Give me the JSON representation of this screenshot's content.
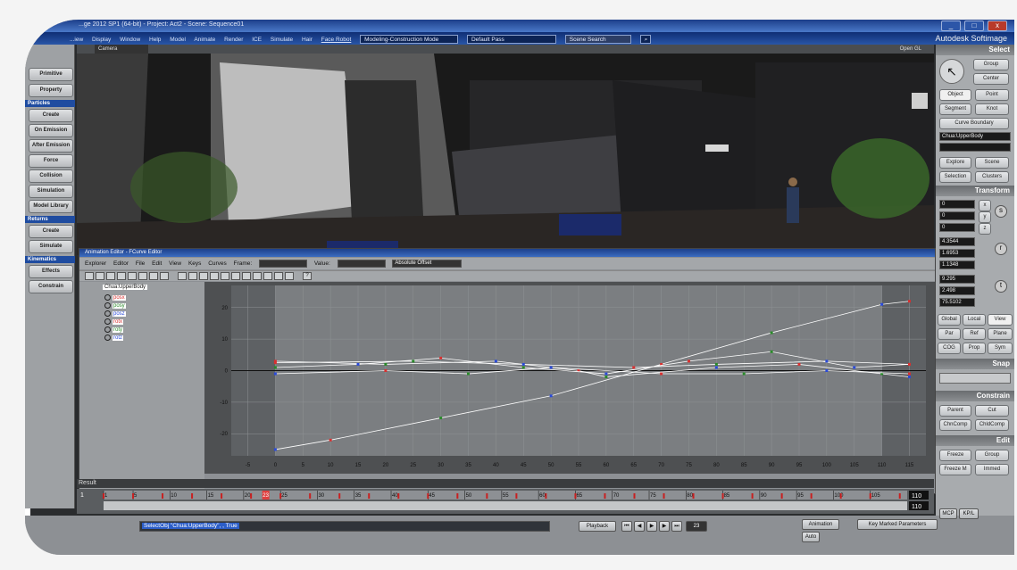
{
  "window": {
    "title": "...ge 2012 SP1 (64-bit) - Project: Act2 - Scene: Sequence01",
    "brand": "Autodesk Softimage",
    "controls": [
      "_",
      "□",
      "x"
    ]
  },
  "menubar": {
    "items": [
      "...iew",
      "Display",
      "Window",
      "Help",
      "Model",
      "Animate",
      "Render",
      "ICE",
      "Simulate",
      "Hair",
      "Face Robot"
    ],
    "mode_select": "Modeling-Construction Mode",
    "pass_select": "Default Pass",
    "scene_search_placeholder": "Scene Search"
  },
  "left_panel": {
    "buttons_top": [
      "Primitive",
      "Property"
    ],
    "section_particles": "Particles",
    "buttons_particles": [
      "Create",
      "On Emission",
      "After Emission",
      "Force",
      "Collision",
      "Simulation",
      "Model Library"
    ],
    "section_returns": "Returns",
    "buttons_returns": [
      "Create",
      "Simulate"
    ],
    "section_kinematics": "Kinematics",
    "buttons_kinematics": [
      "Effects",
      "Constrain"
    ]
  },
  "viewport": {
    "camera": "Camera",
    "label": "Open GL"
  },
  "right_panel": {
    "select_header": "Select",
    "group": "Group",
    "center": "Center",
    "object": "Object",
    "point": "Point",
    "segment": "Segment",
    "knot": "Knot",
    "curve_boundary": "Curve Boundary",
    "selected_object": "Chua:UpperBody",
    "explore": "Explore",
    "scene": "Scene",
    "selection": "Selection",
    "clusters": "Clusters",
    "transform_header": "Transform",
    "transform_values": [
      "0",
      "0",
      "0",
      "4.3544",
      "1.6953",
      "1.1348",
      "9.295",
      "2.498",
      "75.5102"
    ],
    "axes": [
      "x",
      "y",
      "z"
    ],
    "global_local_view": [
      "Global",
      "Local",
      "View"
    ],
    "par": [
      "Par",
      "Ref",
      "Plane"
    ],
    "cog_prop_sym": [
      "COG",
      "Prop",
      "Sym"
    ],
    "snap_header": "Snap",
    "constrain_header": "Constrain",
    "parent": "Parent",
    "cut": "Cut",
    "chncomp": "ChnComp",
    "chldcomp": "ChldComp",
    "edit_header": "Edit",
    "freeze": "Freeze",
    "group2": "Group",
    "freeze_m": "Freeze M",
    "immed": "Immed"
  },
  "animation_editor": {
    "title": "Animation Editor - FCurve Editor",
    "menu": [
      "Explorer",
      "Editor",
      "File",
      "Edit",
      "View",
      "Keys",
      "Curves"
    ],
    "frame_label": "Frame:",
    "value_label": "Value:",
    "offset_mode": "Absolute Offset",
    "tree_root": "Chua:UpperBody",
    "tree_items": [
      {
        "label": "posx",
        "color": "#d83030"
      },
      {
        "label": "posy",
        "color": "#2a8a2a"
      },
      {
        "label": "posz",
        "color": "#2a4ad8"
      },
      {
        "label": "rotx",
        "color": "#d83030"
      },
      {
        "label": "roty",
        "color": "#2a8a2a"
      },
      {
        "label": "rotz",
        "color": "#2a4ad8"
      }
    ],
    "y_ticks": [
      "20",
      "10",
      "0",
      "-10",
      "-20"
    ],
    "x_ticks": [
      "-5",
      "0",
      "5",
      "10",
      "15",
      "20",
      "25",
      "30",
      "35",
      "40",
      "45",
      "50",
      "55",
      "60",
      "65",
      "70",
      "75",
      "80",
      "85",
      "90",
      "95",
      "100",
      "105",
      "110",
      "115"
    ]
  },
  "result_label": "Result",
  "timeline": {
    "start": "1",
    "end": "110",
    "current_frame": "23",
    "end_field": "110",
    "ticks": [
      "1",
      "5",
      "10",
      "15",
      "20",
      "25",
      "30",
      "35",
      "40",
      "45",
      "50",
      "55",
      "60",
      "65",
      "70",
      "75",
      "80",
      "85",
      "90",
      "95",
      "100",
      "105"
    ]
  },
  "bottombar": {
    "command": "SelectObj \"Chua:UpperBody\", , True",
    "playback": "Playback",
    "frame_value": "23",
    "animation": "Animation",
    "auto": "Auto",
    "key_marked": "Key Marked Parameters",
    "mcp": "MCP",
    "kpl": "KP/L"
  }
}
